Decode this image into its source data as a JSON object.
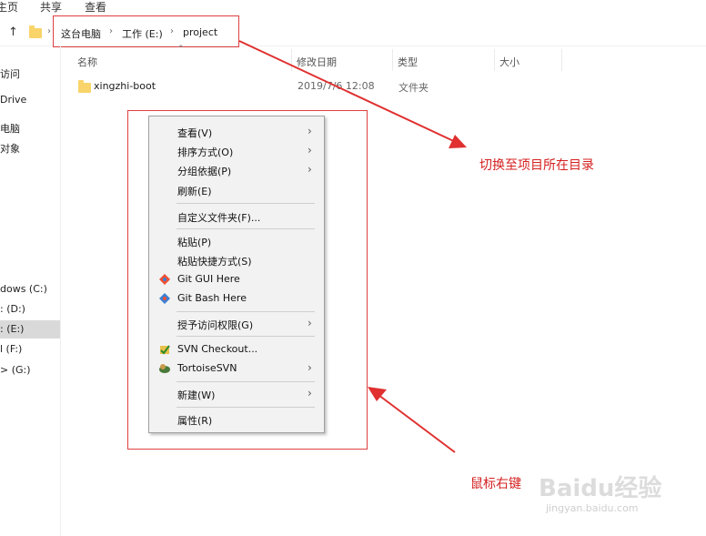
{
  "ribbon": {
    "tabs": [
      "主页",
      "共享",
      "查看"
    ]
  },
  "breadcrumb": {
    "items": [
      "这台电脑",
      "工作 (E:)",
      "project"
    ]
  },
  "sidebar": {
    "items": [
      "访问",
      "Drive",
      "电脑",
      "对象",
      "",
      "",
      "",
      "",
      "",
      "",
      "dows (C:)",
      ": (D:)",
      ": (E:)",
      "l (F:)",
      "> (G:)"
    ]
  },
  "columns": [
    "名称",
    "修改日期",
    "类型",
    "大小"
  ],
  "files": [
    {
      "name": "xingzhi-boot",
      "modified": "2019/7/6 12:08",
      "type": "文件夹"
    }
  ],
  "context_menu": {
    "items": [
      {
        "label": "查看(V)",
        "submenu": true
      },
      {
        "label": "排序方式(O)",
        "submenu": true
      },
      {
        "label": "分组依据(P)",
        "submenu": true
      },
      {
        "label": "刷新(E)",
        "submenu": false
      },
      {
        "label": "自定义文件夹(F)...",
        "submenu": false
      },
      {
        "label": "粘贴(P)",
        "submenu": false
      },
      {
        "label": "粘贴快捷方式(S)",
        "submenu": false
      },
      {
        "label": "Git GUI Here",
        "submenu": false,
        "icon": "git-gui-icon"
      },
      {
        "label": "Git Bash Here",
        "submenu": false,
        "icon": "git-bash-icon"
      },
      {
        "label": "授予访问权限(G)",
        "submenu": true
      },
      {
        "label": "SVN Checkout...",
        "submenu": false,
        "icon": "svn-checkout-icon"
      },
      {
        "label": "TortoiseSVN",
        "submenu": true,
        "icon": "tortoisesvn-icon"
      },
      {
        "label": "新建(W)",
        "submenu": true
      },
      {
        "label": "属性(R)",
        "submenu": false
      }
    ]
  },
  "annotations": {
    "top": "切换至项目所在目录",
    "bottom": "鼠标右键"
  },
  "watermark": {
    "brand": "Baidu经验",
    "url": "jingyan.baidu.com"
  },
  "colors": {
    "annotation": "#d42020",
    "folder": "#f9d46a",
    "selected": "#d9d9d9"
  }
}
